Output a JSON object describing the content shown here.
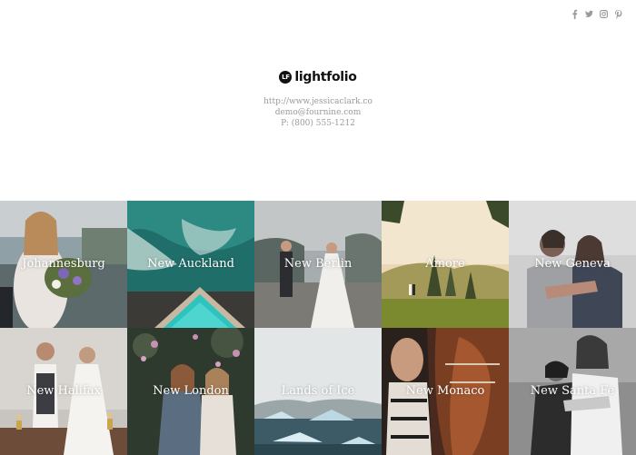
{
  "social": [
    {
      "name": "facebook-icon"
    },
    {
      "name": "twitter-icon"
    },
    {
      "name": "instagram-icon"
    },
    {
      "name": "pinterest-icon"
    }
  ],
  "brand": {
    "mark": "LF",
    "name": "lightfolio"
  },
  "contact": {
    "website": "http://www.jessicaclark.co",
    "email": "demo@fournine.com",
    "phone": "P: (800) 555-1212"
  },
  "galleries": [
    {
      "title": "Johannesburg"
    },
    {
      "title": "New Auckland"
    },
    {
      "title": "New Berlin"
    },
    {
      "title": "Amore"
    },
    {
      "title": "New Geneva"
    },
    {
      "title": "New Halifax"
    },
    {
      "title": "New London"
    },
    {
      "title": "Lands of Ice"
    },
    {
      "title": "New Monaco"
    },
    {
      "title": "New Santa Fe"
    }
  ]
}
